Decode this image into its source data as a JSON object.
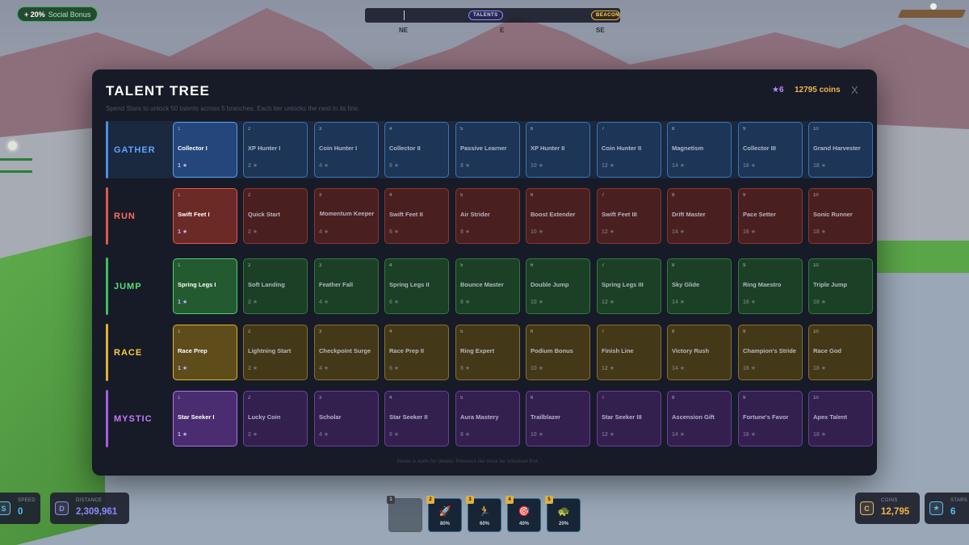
{
  "hud": {
    "social_bonus": {
      "value": "+ 20%",
      "label": "Social Bonus"
    },
    "compass": {
      "labels": [
        "NE",
        "E",
        "SE"
      ],
      "pill_talents": "TALENTS",
      "pill_beacon": "BEACON"
    },
    "stats_left": [
      {
        "icon": "S",
        "label": "SPEED",
        "value": "0",
        "color": "#4fc3f7"
      },
      {
        "icon": "D",
        "label": "DISTANCE",
        "value": "2,309,961",
        "color": "#8b8bff"
      }
    ],
    "stats_right": [
      {
        "icon": "C",
        "label": "COINS",
        "value": "12,795",
        "color": "#f1b64a"
      },
      {
        "icon": "★",
        "label": "STARS",
        "value": "6",
        "color": "#4fc3f7"
      }
    ],
    "hotbar": [
      {
        "num": "1",
        "icon": "empty-slot-icon",
        "glyph": "",
        "pct": ""
      },
      {
        "num": "2",
        "icon": "rocket-icon",
        "glyph": "🚀",
        "pct": "80%"
      },
      {
        "num": "3",
        "icon": "runner-icon",
        "glyph": "🏃",
        "pct": "60%"
      },
      {
        "num": "4",
        "icon": "target-icon",
        "glyph": "🎯",
        "pct": "40%"
      },
      {
        "num": "5",
        "icon": "turtle-icon",
        "glyph": "🐢",
        "pct": "20%"
      }
    ]
  },
  "modal": {
    "title": "TALENT TREE",
    "subtitle": "Spend Stars to unlock 50 talents across 5 branches. Each tier unlocks the next in its line.",
    "stars": "★6",
    "coins": "12795 coins",
    "close": "X",
    "hint": "Hover a node for details. Previous tier must be unlocked first.",
    "branches": [
      {
        "name": "GATHER",
        "color": "#4a8fe0",
        "label_color": "#5fa6ff",
        "bg": "#1d3556",
        "border": "#3a74b8",
        "bg_on": "#24467a",
        "border_on": "#5aa0f0",
        "nodes": [
          "Collector I",
          "XP Hunter I",
          "Coin Hunter I",
          "Collector II",
          "Passive Learner",
          "XP Hunter II",
          "Coin Hunter II",
          "Magnetism",
          "Collector III",
          "Grand Harvester"
        ]
      },
      {
        "name": "RUN",
        "color": "#e05a4a",
        "label_color": "#ff6f5e",
        "bg": "#4a1f20",
        "border": "#8e3530",
        "bg_on": "#6b2a26",
        "border_on": "#e0584a",
        "nodes": [
          "Swift Feet I",
          "Quick Start",
          "Momentum Keeper",
          "Swift Feet II",
          "Air Strider",
          "Boost Extender",
          "Swift Feet III",
          "Drift Master",
          "Pace Setter",
          "Sonic Runner"
        ]
      },
      {
        "name": "JUMP",
        "color": "#3fbf5f",
        "label_color": "#58e07a",
        "bg": "#1b4025",
        "border": "#2f7a3f",
        "bg_on": "#245a30",
        "border_on": "#4fcf6a",
        "nodes": [
          "Spring Legs I",
          "Soft Landing",
          "Feather Fall",
          "Spring Legs II",
          "Bounce Master",
          "Double Jump",
          "Spring Legs III",
          "Sky Glide",
          "Ring Maestro",
          "Triple Jump"
        ]
      },
      {
        "name": "RACE",
        "color": "#e0b030",
        "label_color": "#ffcc40",
        "bg": "#433817",
        "border": "#8a7326",
        "bg_on": "#5e4d1b",
        "border_on": "#e0b433",
        "nodes": [
          "Race Prep",
          "Lightning Start",
          "Checkpoint Surge",
          "Race Prep II",
          "Ring Expert",
          "Podium Bonus",
          "Finish Line",
          "Victory Rush",
          "Champion's Stride",
          "Race God"
        ]
      },
      {
        "name": "MYSTIC",
        "color": "#a45de0",
        "label_color": "#c47aff",
        "bg": "#33204f",
        "border": "#6a3fa0",
        "bg_on": "#4a2d70",
        "border_on": "#b070f0",
        "nodes": [
          "Star Seeker I",
          "Lucky Coin",
          "Scholar",
          "Star Seeker II",
          "Aura Mastery",
          "Trailblazer",
          "Star Seeker III",
          "Ascension Gift",
          "Fortune's Favor",
          "Apex Talent"
        ]
      }
    ],
    "costs": [
      "1 ★",
      "2 ★",
      "4 ★",
      "6 ★",
      "8 ★",
      "10 ★",
      "12 ★",
      "14 ★",
      "16 ★",
      "18 ★"
    ],
    "tiers": [
      "1",
      "2",
      "3",
      "4",
      "5",
      "6",
      "7",
      "8",
      "9",
      "10"
    ]
  }
}
